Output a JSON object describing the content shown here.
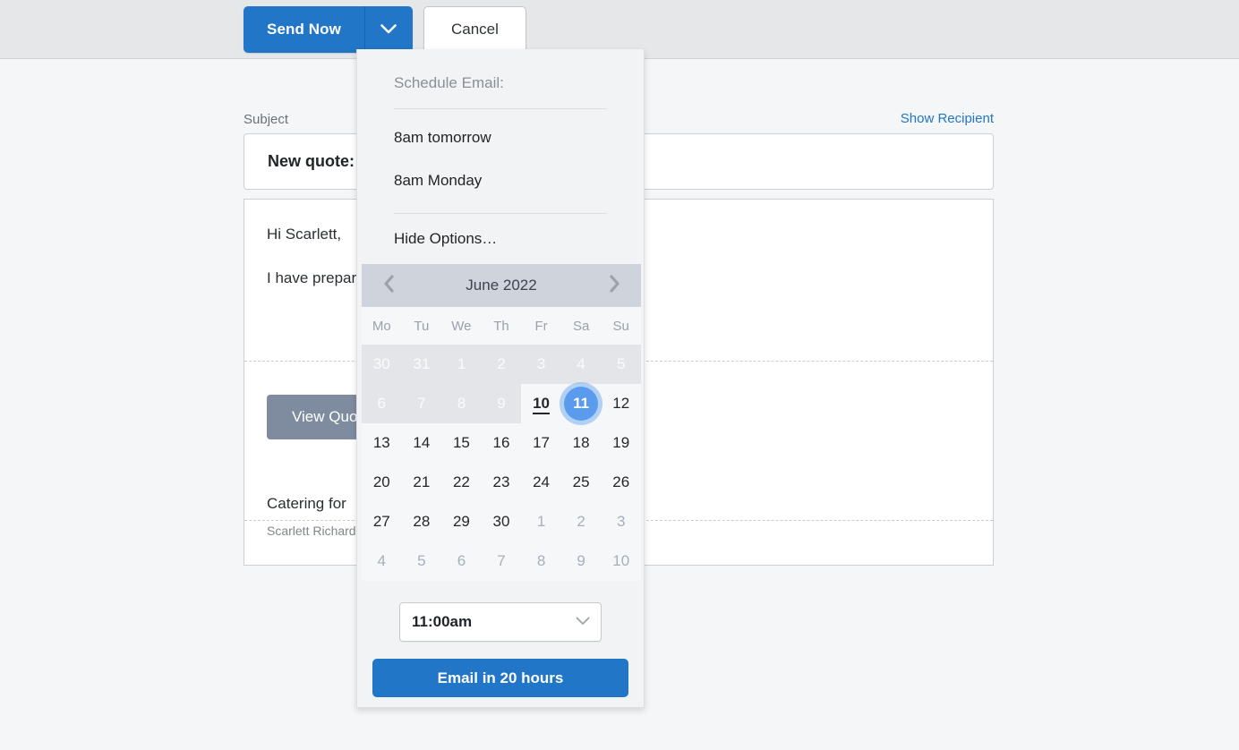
{
  "toolbar": {
    "send_label": "Send Now",
    "caret_icon": "chevron-down-icon",
    "cancel_label": "Cancel"
  },
  "compose": {
    "subject_label": "Subject",
    "show_recipient_label": "Show Recipient",
    "subject_value": "New quote:",
    "greeting": "Hi Scarlett,",
    "paragraph": "I have prepar",
    "quote_button_label": "View Quo",
    "signature_title": "Catering for",
    "signature_name": "Scarlett Richards"
  },
  "schedule_popup": {
    "heading": "Schedule Email:",
    "presets": [
      {
        "label": "8am tomorrow"
      },
      {
        "label": "8am Monday"
      }
    ],
    "hide_options_label": "Hide Options…",
    "calendar": {
      "prev_icon": "chevron-left-icon",
      "next_icon": "chevron-right-icon",
      "title": "June 2022",
      "day_headers": [
        "Mo",
        "Tu",
        "We",
        "Th",
        "Fr",
        "Sa",
        "Su"
      ],
      "weeks": [
        [
          {
            "n": "30",
            "state": "disabled"
          },
          {
            "n": "31",
            "state": "disabled"
          },
          {
            "n": "1",
            "state": "disabled"
          },
          {
            "n": "2",
            "state": "disabled"
          },
          {
            "n": "3",
            "state": "disabled"
          },
          {
            "n": "4",
            "state": "disabled"
          },
          {
            "n": "5",
            "state": "disabled"
          }
        ],
        [
          {
            "n": "6",
            "state": "disabled"
          },
          {
            "n": "7",
            "state": "disabled"
          },
          {
            "n": "8",
            "state": "disabled"
          },
          {
            "n": "9",
            "state": "disabled"
          },
          {
            "n": "10",
            "state": "today"
          },
          {
            "n": "11",
            "state": "selected"
          },
          {
            "n": "12",
            "state": "normal"
          }
        ],
        [
          {
            "n": "13",
            "state": "normal"
          },
          {
            "n": "14",
            "state": "normal"
          },
          {
            "n": "15",
            "state": "normal"
          },
          {
            "n": "16",
            "state": "normal"
          },
          {
            "n": "17",
            "state": "normal"
          },
          {
            "n": "18",
            "state": "normal"
          },
          {
            "n": "19",
            "state": "normal"
          }
        ],
        [
          {
            "n": "20",
            "state": "normal"
          },
          {
            "n": "21",
            "state": "normal"
          },
          {
            "n": "22",
            "state": "normal"
          },
          {
            "n": "23",
            "state": "normal"
          },
          {
            "n": "24",
            "state": "normal"
          },
          {
            "n": "25",
            "state": "normal"
          },
          {
            "n": "26",
            "state": "normal"
          }
        ],
        [
          {
            "n": "27",
            "state": "normal"
          },
          {
            "n": "28",
            "state": "normal"
          },
          {
            "n": "29",
            "state": "normal"
          },
          {
            "n": "30",
            "state": "normal"
          },
          {
            "n": "1",
            "state": "othermonth"
          },
          {
            "n": "2",
            "state": "othermonth"
          },
          {
            "n": "3",
            "state": "othermonth"
          }
        ],
        [
          {
            "n": "4",
            "state": "othermonth"
          },
          {
            "n": "5",
            "state": "othermonth"
          },
          {
            "n": "6",
            "state": "othermonth"
          },
          {
            "n": "7",
            "state": "othermonth"
          },
          {
            "n": "8",
            "state": "othermonth"
          },
          {
            "n": "9",
            "state": "othermonth"
          },
          {
            "n": "10",
            "state": "othermonth"
          }
        ]
      ]
    },
    "time": {
      "value": "11:00am",
      "caret_icon": "chevron-down-icon"
    },
    "submit_label": "Email in 20 hours"
  },
  "colors": {
    "accent_blue": "#2176c7",
    "selected_day": "#5b9bed",
    "quote_button": "#7f8c9f",
    "toolbar_bg": "#e6e7e9",
    "page_bg": "#f5f6f7",
    "calendar_header": "#ced3dc"
  }
}
